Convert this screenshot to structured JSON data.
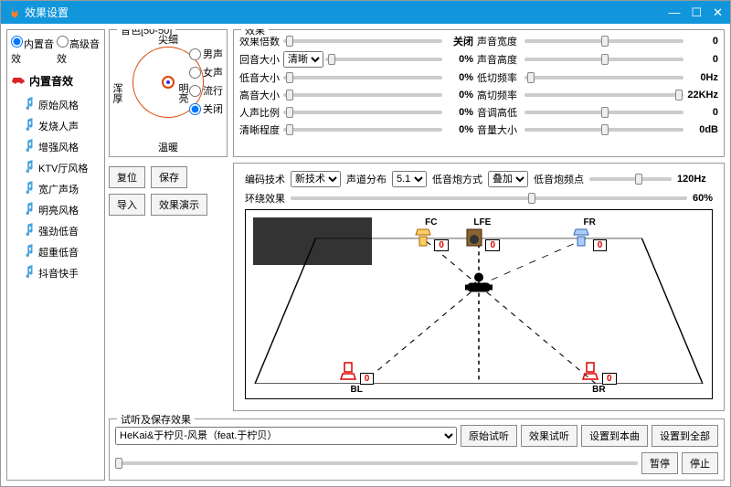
{
  "window": {
    "title": "效果设置"
  },
  "sidebar": {
    "mode_builtin": "内置音效",
    "mode_advanced": "高级音效",
    "section_title": "内置音效",
    "presets": [
      "原始风格",
      "发烧人声",
      "增强风格",
      "KTV厅风格",
      "宽广声场",
      "明亮风格",
      "强劲低音",
      "超重低音",
      "抖音快手"
    ]
  },
  "tone": {
    "legend": "音色[50-50]",
    "top": "尖细",
    "bottom": "温暖",
    "left": "浑厚",
    "right": "明亮",
    "voices": [
      "男声",
      "女声",
      "流行",
      "关闭"
    ]
  },
  "effects": {
    "legend": "效果",
    "rows_left": [
      {
        "label": "效果倍数",
        "val": "关闭"
      },
      {
        "label": "回音大小",
        "val": "0%",
        "select": "清晰"
      },
      {
        "label": "低音大小",
        "val": "0%"
      },
      {
        "label": "高音大小",
        "val": "0%"
      },
      {
        "label": "人声比例",
        "val": "0%"
      },
      {
        "label": "清晰程度",
        "val": "0%"
      }
    ],
    "rows_right": [
      {
        "label": "声音宽度",
        "val": "0"
      },
      {
        "label": "声音高度",
        "val": "0"
      },
      {
        "label": "低切频率",
        "val": "0Hz"
      },
      {
        "label": "高切频率",
        "val": "22KHz"
      },
      {
        "label": "音调高低",
        "val": "0"
      },
      {
        "label": "音量大小",
        "val": "0dB"
      }
    ]
  },
  "buttons": {
    "reset": "复位",
    "save": "保存",
    "import": "导入",
    "demo": "效果演示"
  },
  "surround": {
    "enc_label": "编码技术",
    "enc_val": "新技术",
    "ch_label": "声道分布",
    "ch_val": "5.1",
    "bassmode_label": "低音炮方式",
    "bassmode_val": "叠加",
    "bassfreq_label": "低音炮频点",
    "bassfreq_val": "120Hz",
    "env_label": "环绕效果",
    "env_val": "60%",
    "speakers": {
      "FC": {
        "name": "FC",
        "val": "0"
      },
      "LFE": {
        "name": "LFE",
        "val": "0"
      },
      "FR": {
        "name": "FR",
        "val": "0"
      },
      "BL": {
        "name": "BL",
        "val": "0"
      },
      "BR": {
        "name": "BR",
        "val": "0"
      }
    }
  },
  "listen": {
    "legend": "试听及保存效果",
    "song": "HeKai&于柠贝-风景（feat.于柠贝）",
    "btn_orig": "原始试听",
    "btn_eff": "效果试听",
    "btn_save_cur": "设置到本曲",
    "btn_save_all": "设置到全部",
    "btn_pause": "暂停",
    "btn_stop": "停止"
  }
}
